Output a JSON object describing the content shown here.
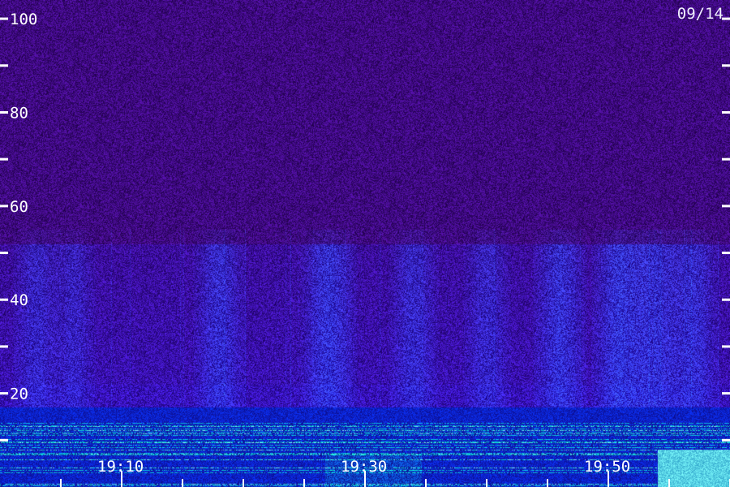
{
  "date_label": "09/14",
  "chart_data": {
    "type": "heatmap",
    "title": "",
    "xlabel": "",
    "ylabel": "",
    "y_ticks": [
      {
        "value": 20,
        "label": "20"
      },
      {
        "value": 40,
        "label": "40"
      },
      {
        "value": 60,
        "label": "60"
      },
      {
        "value": 80,
        "label": "80"
      },
      {
        "value": 100,
        "label": "100"
      }
    ],
    "y_minor_ticks": [
      10,
      30,
      50,
      70,
      90
    ],
    "ylim": [
      0,
      104
    ],
    "x_ticks": [
      {
        "value": 0,
        "label": "19:10"
      },
      {
        "value": 20,
        "label": "19:30"
      },
      {
        "value": 40,
        "label": "19:50"
      }
    ],
    "xlim": [
      -10,
      50
    ],
    "x_minor_ticks": [
      -5,
      5,
      10,
      15,
      25,
      30,
      35,
      45,
      50
    ],
    "colors": {
      "background": "#140050",
      "noise": "#2a1aa0",
      "band": "#3050ff",
      "strong": "#30ffa0",
      "axis": "#ffffff"
    },
    "vertical_streaks": [
      {
        "x": -7,
        "intensity": 0.35
      },
      {
        "x": -4,
        "intensity": 0.3
      },
      {
        "x": 8,
        "intensity": 0.45
      },
      {
        "x": 17,
        "intensity": 0.55
      },
      {
        "x": 24,
        "intensity": 0.4
      },
      {
        "x": 30,
        "intensity": 0.35
      },
      {
        "x": 36,
        "intensity": 0.5
      },
      {
        "x": 41,
        "intensity": 0.6
      },
      {
        "x": 44,
        "intensity": 0.5
      },
      {
        "x": 47,
        "intensity": 0.45
      }
    ]
  }
}
